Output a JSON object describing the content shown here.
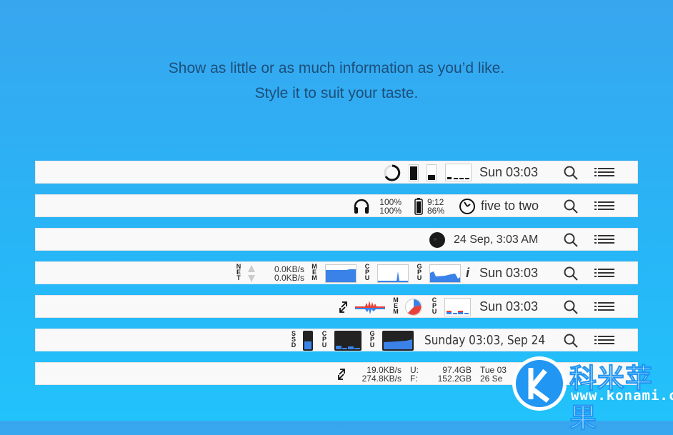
{
  "headline": {
    "line1": "Show as little or as much information as you’d like.",
    "line2": "Style it to suit your taste."
  },
  "bars": [
    {
      "time": "Sun 03:03"
    },
    {
      "headphones_left": "100%",
      "headphones_right": "100%",
      "battery_time": "9:12",
      "battery_pct": "86%",
      "fuzzy_time": "five to two"
    },
    {
      "datetime": "24 Sep, 3:03 AM"
    },
    {
      "net_label": "NET",
      "net_up": "0.0KB/s",
      "net_down": "0.0KB/s",
      "mem_label": "MEM",
      "cpu_label": "CPU",
      "gpu_label": "GPU",
      "info": "i",
      "time": "Sun 03:03"
    },
    {
      "mem_label": "MEM",
      "cpu_label": "CPU",
      "time": "Sun 03:03"
    },
    {
      "ssd_label": "SSD",
      "cpu_label": "CPU",
      "gpu_label": "GPU",
      "datetime": "Sunday 03:03, Sep 24"
    },
    {
      "net_up": "19.0KB/s",
      "net_down": "274.8KB/s",
      "used_label": "U:",
      "used": "97.4GB",
      "free_label": "F:",
      "free": "152.2GB",
      "date1": "Tue 03",
      "date2": "26 Se"
    }
  ],
  "watermark": {
    "text": "科米苹果",
    "url": "www.konami.cc"
  },
  "colors": {
    "accent": "#3b82e8",
    "red": "#e8403a",
    "bg": "#2ab4f6"
  }
}
